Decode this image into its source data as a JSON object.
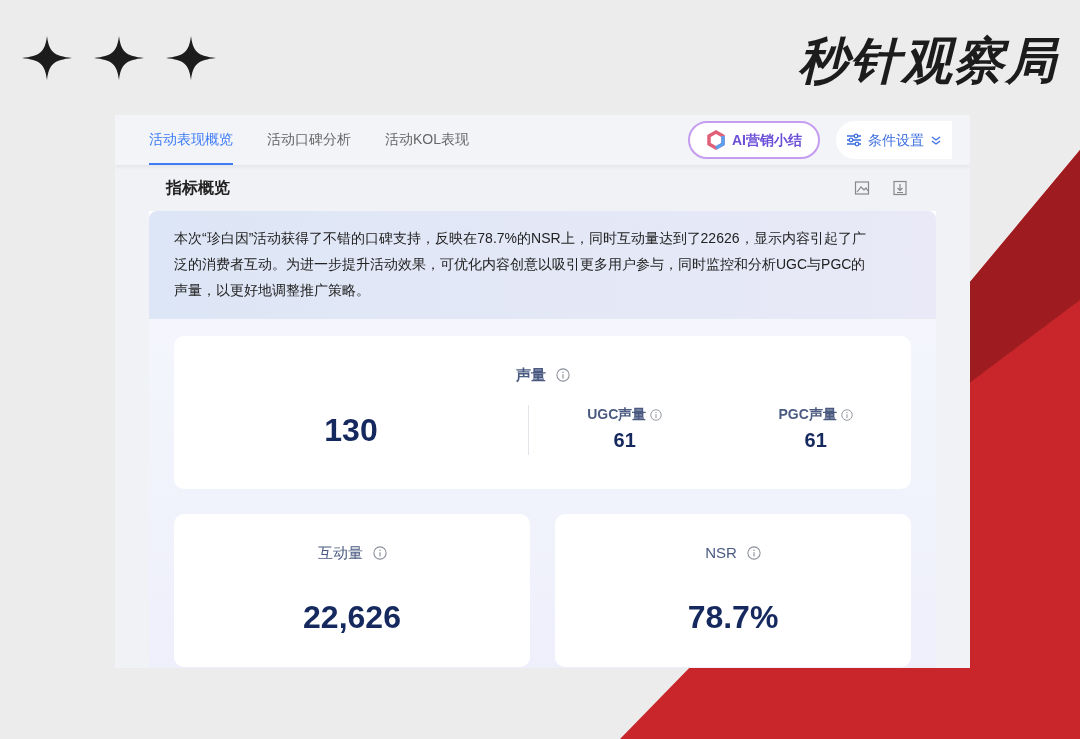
{
  "brand": "秒针观察局",
  "tabs": [
    {
      "label": "活动表现概览",
      "selected": true
    },
    {
      "label": "活动口碑分析",
      "selected": false
    },
    {
      "label": "活动KOL表现",
      "selected": false
    }
  ],
  "ai_button": {
    "label": "AI营销小结"
  },
  "settings_button": {
    "label": "条件设置"
  },
  "section": {
    "title": "指标概览"
  },
  "summary": "本次“珍白因”活动获得了不错的口碑支持，反映在78.7%的NSR上，同时互动量达到了22626，显示内容引起了广泛的消费者互动。为进一步提升活动效果，可优化内容创意以吸引更多用户参与，同时监控和分析UGC与PGC的声量，以更好地调整推广策略。",
  "volume": {
    "label": "声量",
    "value": "130",
    "breakdown": [
      {
        "label": "UGC声量",
        "value": "61"
      },
      {
        "label": "PGC声量",
        "value": "61"
      }
    ]
  },
  "cards": [
    {
      "label": "互动量",
      "value": "22,626"
    },
    {
      "label": "NSR",
      "value": "78.7%"
    }
  ]
}
